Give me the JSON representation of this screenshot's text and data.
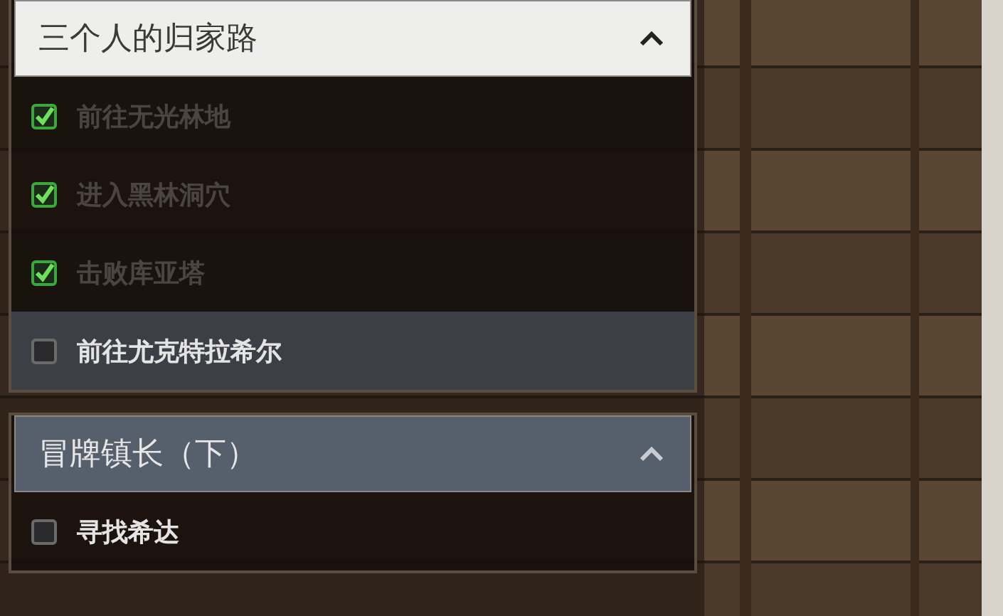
{
  "quests": [
    {
      "title": "三个人的归家路",
      "selected": true,
      "expanded": true,
      "tasks": [
        {
          "label": "前往无光林地",
          "checked": true,
          "selected": false
        },
        {
          "label": "进入黑林洞穴",
          "checked": true,
          "selected": false
        },
        {
          "label": "击败库亚塔",
          "checked": true,
          "selected": false
        },
        {
          "label": "前往尤克特拉希尔",
          "checked": false,
          "selected": true
        }
      ]
    },
    {
      "title": "冒牌镇长（下）",
      "selected": false,
      "expanded": true,
      "tasks": [
        {
          "label": "寻找希达",
          "checked": false,
          "selected": false
        }
      ]
    }
  ]
}
